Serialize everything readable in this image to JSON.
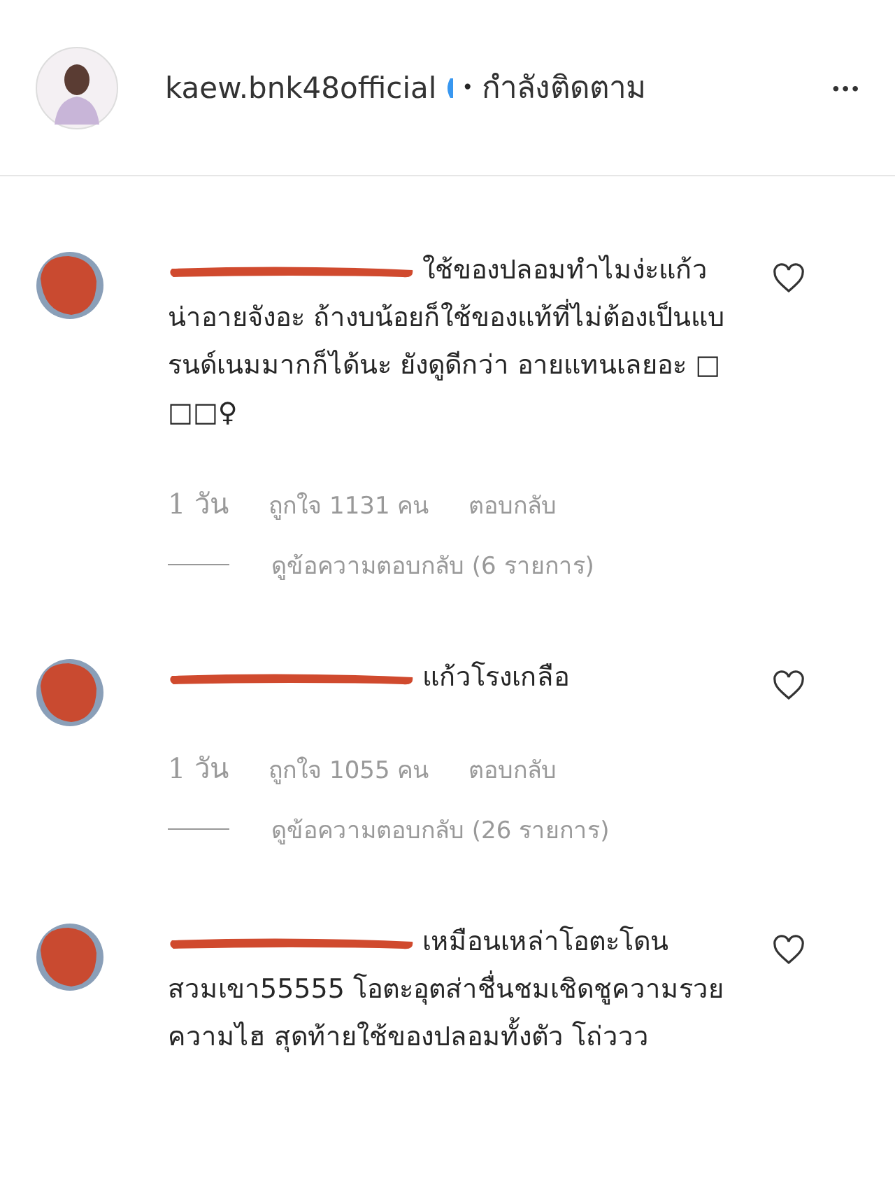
{
  "header": {
    "username": "kaew.bnk48official",
    "verified": true,
    "separator": "•",
    "follow_status": "กำลังติดตาม",
    "more": "•••"
  },
  "comments": [
    {
      "text": "ใช้ของปลอมทำไมง่ะแก้ว น่าอายจังอะ ถ้างบน้อยก็ใช้ของแท้ที่ไม่ต้องเป็นแบรนด์เนมมากก็ได้นะ ยังดูดีกว่า อายแทนเลยอะ □ □□♀",
      "time": "1 วัน",
      "likes": "ถูกใจ 1131 คน",
      "reply": "ตอบกลับ",
      "view_replies": "ดูข้อความตอบกลับ (6 รายการ)"
    },
    {
      "text": "แก้วโรงเกลือ",
      "time": "1 วัน",
      "likes": "ถูกใจ 1055 คน",
      "reply": "ตอบกลับ",
      "view_replies": "ดูข้อความตอบกลับ (26 รายการ)"
    },
    {
      "text": "เหมือนเหล่าโอตะโดนสวมเขา55555 โอตะอุตส่าชื่นชมเชิดชูความรวยความไฮ สุดท้ายใช้ของปลอมทั้งตัว โถ่ววว"
    }
  ]
}
